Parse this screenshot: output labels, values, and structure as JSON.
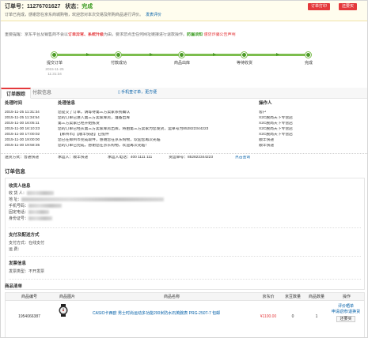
{
  "header": {
    "order_label": "订单号：",
    "order_no": "11276701627",
    "status_label": "状态：",
    "status": "完成",
    "notice": "订单已完成，感谢您在京东商城购物，欢迎您对本次交易及所购商品进行评价。",
    "notice_link": "发表评价",
    "btn_print": "订单打印",
    "btn_rebuy": "还要买"
  },
  "reminder": {
    "pre": "重要提醒：京东平台及销售商不会以",
    "red1": "订单异常、系统升级",
    "mid": "为由，要求您点击任何网址链接进行退款操作。",
    "green": "防骗须知",
    "link": "谨防诈骗公告声明"
  },
  "progress": {
    "steps": [
      {
        "label": "提交订单",
        "time1": "2015-11-25",
        "time2": "11:31:34"
      },
      {
        "label": "付款成功",
        "time1": "",
        "time2": ""
      },
      {
        "label": "商品出库",
        "time1": "",
        "time2": ""
      },
      {
        "label": "等待收货",
        "time1": "",
        "time2": ""
      },
      {
        "label": "完成",
        "time1": "",
        "time2": ""
      }
    ]
  },
  "tabs": {
    "items": [
      "订单跟踪",
      "付款信息"
    ],
    "phone_link": "手机查订单，更方便"
  },
  "tracking": {
    "headers": [
      "处理时间",
      "处理信息",
      "操作人"
    ],
    "rows": [
      {
        "time": "2015-11-25 11:31:34",
        "info": "您提交了订单，请等待第三方卖家系统确认",
        "op": "客户"
      },
      {
        "time": "2015-11-25 11:34:54",
        "info": "您的订单已进入第三方卖家库房，准备出库",
        "op": "X2C腕尚天下专营店"
      },
      {
        "time": "2015-11-30 16:05:11",
        "info": "第三方卖家已经开始拣货",
        "op": "X2C腕尚天下专营店"
      },
      {
        "time": "2015-11-30 16:10:23",
        "info": "您的订单已经从第三方卖家库房出库，将由第三方卖家为您发货，运单号为852822344223",
        "op": "X2C腕尚天下专营店"
      },
      {
        "time": "2015-11-30 17:00:02",
        "info": "【郑州市】【顺丰快递】已揽件",
        "op": "X2C腕尚天下专营店"
      },
      {
        "time": "2015-11-30 19:00:00",
        "info": "您已在郑州市完成取件，感谢您在京东购物，欢迎您再次光临",
        "op": "顺丰快递"
      },
      {
        "time": "2015-11-30 19:58:35",
        "info": "您的订单已完成，感谢您在京东购物，欢迎再次光临！",
        "op": "顺丰快递"
      }
    ],
    "foot": {
      "ship_label": "送货方式：普通快递",
      "carrier_label": "承运人：顺丰快递",
      "carrier_tel": "承运人电话：400 1111 111",
      "waybill": "货运单号：852822344223",
      "link": "点击查询"
    }
  },
  "order_info": {
    "title": "订单信息",
    "receiver_title": "收货人信息",
    "fields": [
      {
        "label": "收 货 人："
      },
      {
        "label": "地      址："
      },
      {
        "label": "手机号码："
      },
      {
        "label": "固定电话："
      },
      {
        "label": "身份证号："
      }
    ],
    "payment_title": "支付及配送方式",
    "pay_method": "支付方式：在线支付",
    "freight": "运      费：",
    "invoice_title": "发票信息",
    "invoice_type": "发票类型：不开发票"
  },
  "product_list": {
    "title": "商品清单",
    "headers": [
      "商品编号",
      "商品图片",
      "商品名称",
      "京东价",
      "京豆数量",
      "商品数量",
      "操作"
    ],
    "items": [
      {
        "sku": "1954066387",
        "name": "CASIO卡西欧 男士时尚运动多功能200米防水石英腕表 PRG-250T-7 包邮",
        "price": "¥1100.00",
        "beans": "0",
        "qty": "1",
        "op1": "评价晒单",
        "op2": "申请返修/退换货",
        "op3": "还要买"
      }
    ]
  }
}
